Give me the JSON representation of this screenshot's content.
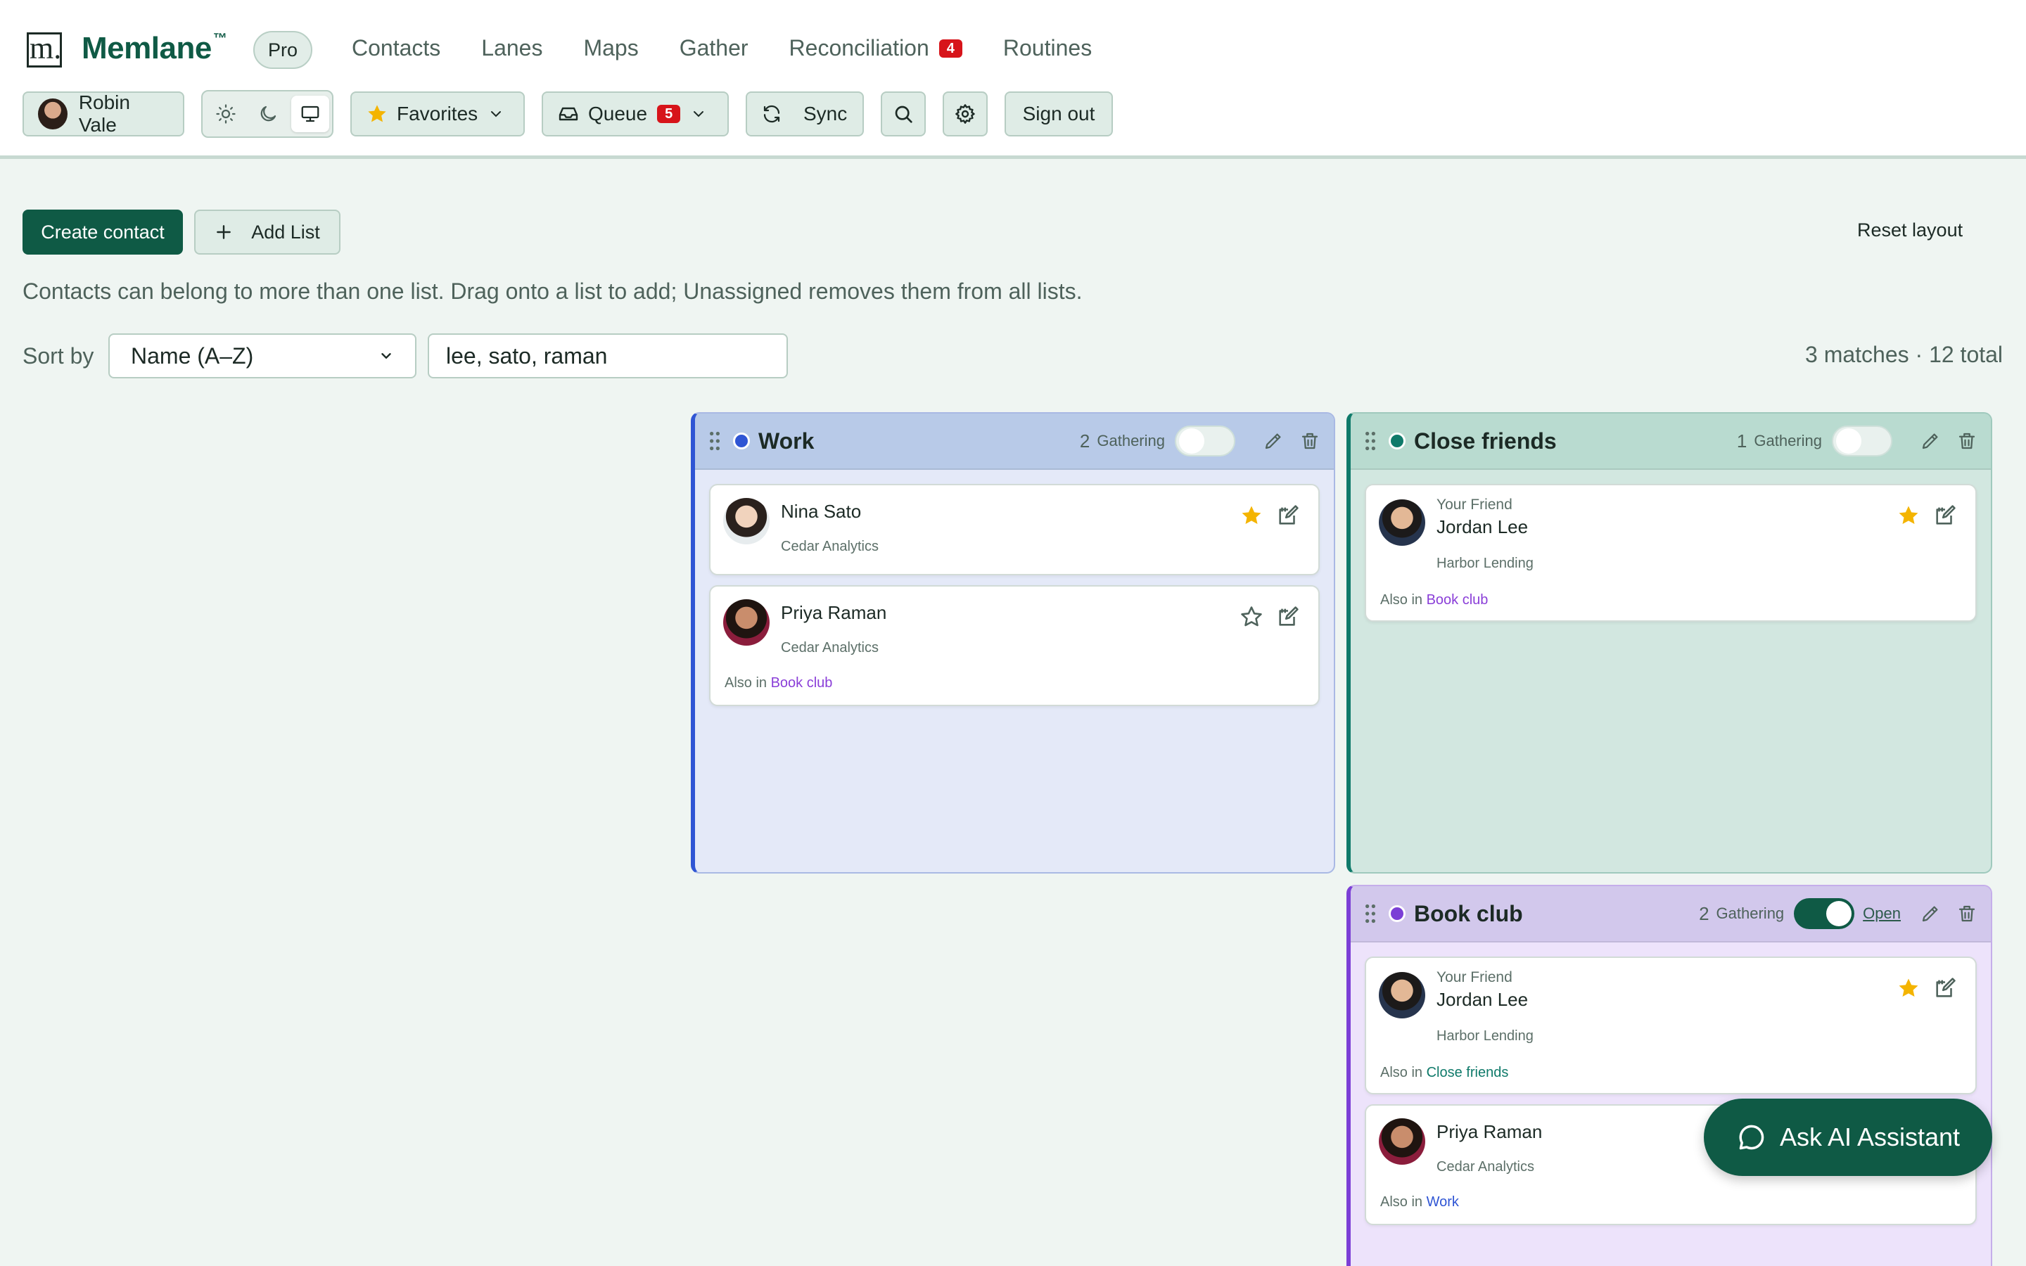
{
  "app": {
    "brand": "Memlane",
    "trademark": "™",
    "logo_letter": "m.",
    "plan_badge": "Pro"
  },
  "nav": {
    "contacts": "Contacts",
    "lanes": "Lanes",
    "maps": "Maps",
    "gather": "Gather",
    "reconciliation": "Reconciliation",
    "reconciliation_badge": "4",
    "routines": "Routines"
  },
  "toolbar": {
    "user_name": "Robin Vale",
    "favorites": "Favorites",
    "queue": "Queue",
    "queue_badge": "5",
    "sync": "Sync",
    "sign_out": "Sign out",
    "theme_active": "system"
  },
  "actions": {
    "create_contact": "Create contact",
    "add_list": "Add List",
    "reset_layout": "Reset layout"
  },
  "hint": "Contacts can belong to more than one list. Drag onto a list to add; Unassigned removes them from all lists.",
  "filters": {
    "sort_label": "Sort by",
    "sort_value": "Name (A–Z)",
    "search_value": "lee, sato, raman",
    "matches": "3 matches · 12 total"
  },
  "lanes": {
    "work": {
      "title": "Work",
      "count": "2",
      "gather_label": "Gathering",
      "gathering_on": false,
      "color": "#2f55d4",
      "cards": [
        {
          "name": "Nina Sato",
          "org": "Cedar Analytics",
          "favorite": true
        },
        {
          "name": "Priya Raman",
          "org": "Cedar Analytics",
          "favorite": false,
          "also_label": "Also in",
          "also_list": "Book club"
        }
      ]
    },
    "close_friends": {
      "title": "Close friends",
      "count": "1",
      "gather_label": "Gathering",
      "gathering_on": false,
      "color": "#0f7a6a",
      "cards": [
        {
          "relation": "Your Friend",
          "name": "Jordan Lee",
          "org": "Harbor Lending",
          "favorite": true,
          "also_label": "Also in",
          "also_list": "Book club"
        }
      ]
    },
    "book_club": {
      "title": "Book club",
      "count": "2",
      "gather_label": "Gathering",
      "gathering_on": true,
      "open_label": "Open",
      "color": "#7b3fd6",
      "cards": [
        {
          "relation": "Your Friend",
          "name": "Jordan Lee",
          "org": "Harbor Lending",
          "favorite": true,
          "also_label": "Also in",
          "also_list": "Close friends"
        },
        {
          "name": "Priya Raman",
          "org": "Cedar Analytics",
          "also_label": "Also in",
          "also_list": "Work"
        }
      ]
    }
  },
  "assistant": {
    "label": "Ask AI Assistant"
  },
  "colors": {
    "brand": "#0f5a45",
    "badge": "#d7141a",
    "star": "#f4b400",
    "link_purple": "#8a3ed8",
    "link_teal": "#0f7a6a",
    "link_blue": "#2f55d4"
  }
}
